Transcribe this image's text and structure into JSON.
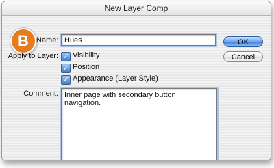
{
  "dialog": {
    "title": "New Layer Comp",
    "badge_letter": "B",
    "name_label": "Name:",
    "name_value": "Hues",
    "apply_label": "Apply to Layer:",
    "checkboxes": [
      {
        "label": "Visibility",
        "checked": true
      },
      {
        "label": "Position",
        "checked": true
      },
      {
        "label": "Appearance (Layer Style)",
        "checked": true
      }
    ],
    "comment_label": "Comment:",
    "comment_value": "Inner page with secondary button navigation.",
    "ok_label": "OK",
    "cancel_label": "Cancel"
  },
  "colors": {
    "badge": "#e87a1e",
    "default_button": "#3b7ddc",
    "focus_ring": "#a9c6e8"
  },
  "icons": {
    "checkmark": "check-icon"
  }
}
